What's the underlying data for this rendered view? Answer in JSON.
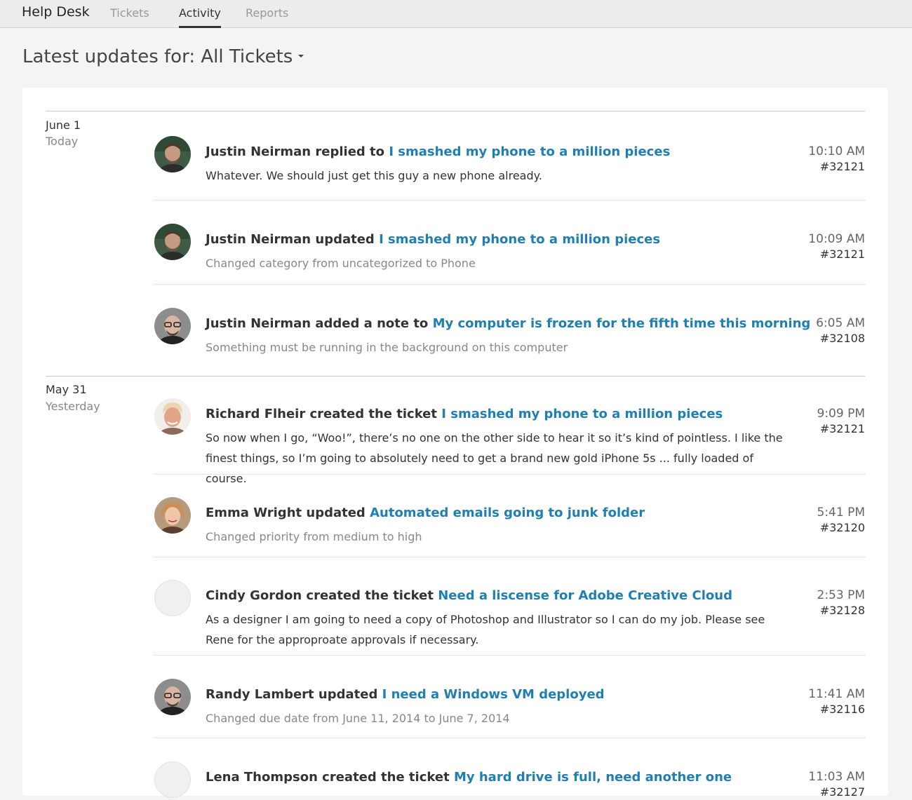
{
  "app": {
    "brand": "Help Desk",
    "tabs": [
      {
        "label": "Tickets",
        "active": false
      },
      {
        "label": "Activity",
        "active": true
      },
      {
        "label": "Reports",
        "active": false
      }
    ]
  },
  "heading": {
    "text": "Latest updates for: All Tickets"
  },
  "colors": {
    "link": "#1f7fb2",
    "muted": "#888888"
  },
  "groups": [
    {
      "date": "June 1",
      "relative": "Today",
      "entries": [
        {
          "actor_action": "Justin Neirman replied to",
          "ticket_title": "I smashed my phone to a million pieces",
          "body": "Whatever. We should just get this guy a new phone already.",
          "time": "10:10 AM",
          "ticket_id": "#32121",
          "avatar": "man-beard"
        },
        {
          "actor_action": "Justin Neirman updated",
          "ticket_title": "I smashed my phone to a million pieces",
          "body": "Changed category from uncategorized to Phone",
          "time": "10:09 AM",
          "ticket_id": "#32121",
          "avatar": "man-beard"
        },
        {
          "actor_action": "Justin Neirman added a note to",
          "ticket_title": "My computer is frozen for the fifth time this morning",
          "body": "Something must be running in the background on this computer",
          "time": "6:05 AM",
          "ticket_id": "#32108",
          "avatar": "man-glasses"
        }
      ]
    },
    {
      "date": "May 31",
      "relative": "Yesterday",
      "entries": [
        {
          "actor_action": "Richard Flheir created the ticket",
          "ticket_title": "I smashed my phone to a million pieces",
          "body": "So now when I go, “Woo!”, there’s no one on the other side to hear it so it’s kind of pointless. I like the finest things, so I’m going to absolutely need to get a brand new gold iPhone 5s ... fully loaded of course.",
          "time": "9:09 PM",
          "ticket_id": "#32121",
          "avatar": "man-blond"
        },
        {
          "actor_action": "Emma Wright updated",
          "ticket_title": "Automated emails going to junk folder",
          "body": "Changed priority from medium to high",
          "time": "5:41 PM",
          "ticket_id": "#32120",
          "avatar": "woman"
        },
        {
          "actor_action": "Cindy Gordon created the ticket",
          "ticket_title": "Need a liscense for Adobe Creative Cloud",
          "body": "As a designer I am going to need a copy of Photoshop and Illustrator so I can do my job. Please see Rene for the approproate approvals if necessary.",
          "time": "2:53 PM",
          "ticket_id": "#32128",
          "avatar": "placeholder"
        },
        {
          "actor_action": "Randy Lambert updated",
          "ticket_title": "I need a Windows VM deployed",
          "body": "Changed due date from June 11, 2014 to June 7, 2014",
          "time": "11:41 AM",
          "ticket_id": "#32116",
          "avatar": "man-glasses"
        },
        {
          "actor_action": "Lena Thompson created the ticket",
          "ticket_title": "My hard drive is full, need another one",
          "body": "",
          "time": "11:03 AM",
          "ticket_id": "#32127",
          "avatar": "placeholder"
        }
      ]
    }
  ]
}
